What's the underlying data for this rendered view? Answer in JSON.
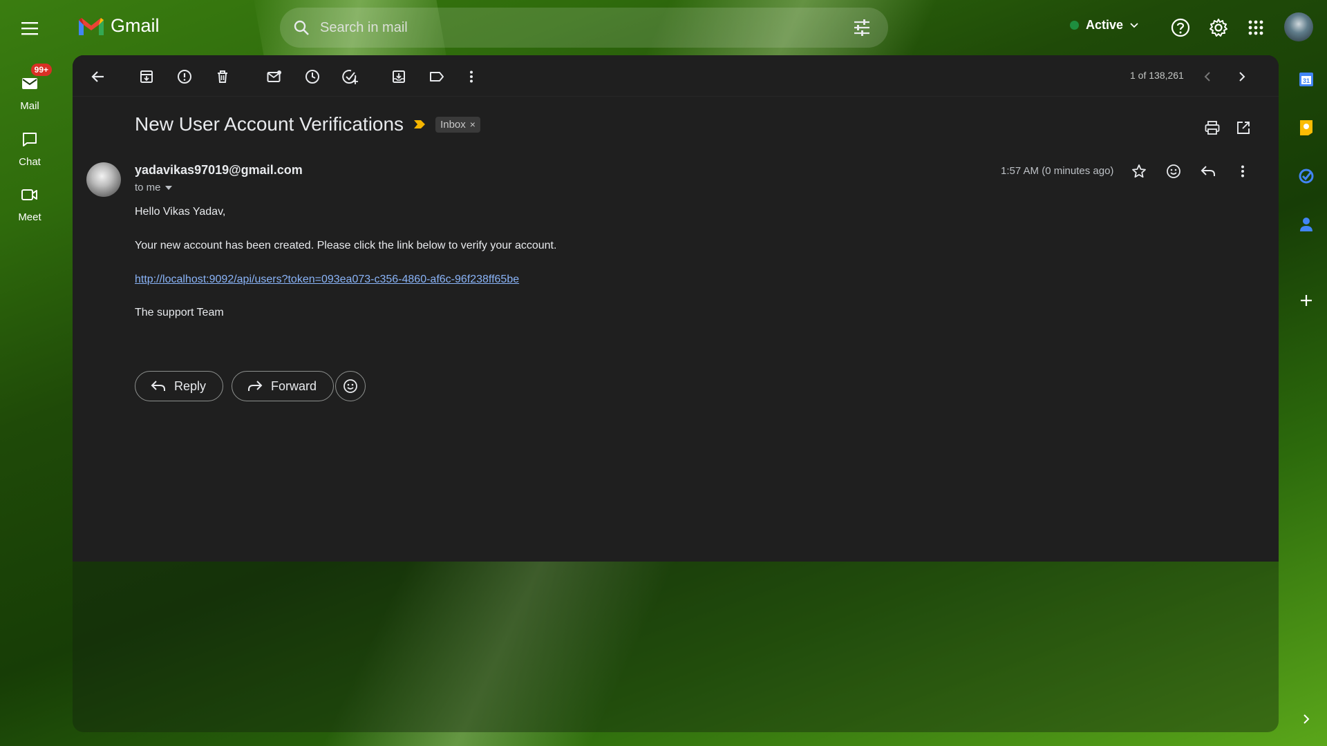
{
  "app": {
    "name": "Gmail"
  },
  "search": {
    "placeholder": "Search in mail"
  },
  "status": {
    "label": "Active",
    "color": "#1e8e3e"
  },
  "rail": {
    "items": [
      {
        "label": "Mail",
        "badge": "99+",
        "icon": "mail-icon"
      },
      {
        "label": "Chat",
        "icon": "chat-icon"
      },
      {
        "label": "Meet",
        "icon": "video-icon"
      }
    ]
  },
  "toolbar": {
    "pager": "1 of 138,261"
  },
  "email": {
    "subject": "New User Account Verifications",
    "label_chip": "Inbox",
    "label_chip_close": "×",
    "sender": "yadavikas97019@gmail.com",
    "to": "to me",
    "time": "1:57 AM (0 minutes ago)",
    "greeting": "Hello Vikas Yadav,",
    "paragraph": "Your new account has been created. Please click the link below to verify your account.",
    "link": "http://localhost:9092/api/users?token=093ea073-c356-4860-af6c-96f238ff65be",
    "signoff": "The support Team"
  },
  "actions": {
    "reply": "Reply",
    "forward": "Forward"
  },
  "colors": {
    "accent_link": "#8ab4f8",
    "badge": "#d93025",
    "panel": "#1f1f1f"
  }
}
